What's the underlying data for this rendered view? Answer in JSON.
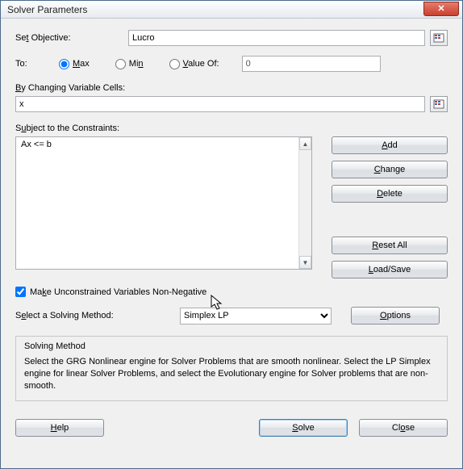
{
  "window": {
    "title": "Solver Parameters"
  },
  "objective": {
    "label_pre": "Se",
    "label_u": "t",
    "label_post": " Objective:",
    "value": "Lucro"
  },
  "to": {
    "label": "To:",
    "max_u": "M",
    "max_post": "ax",
    "min_pre": "Mi",
    "min_u": "n",
    "value_u": "V",
    "value_post": "alue Of:",
    "valueof_value": "0",
    "selected": "max"
  },
  "cells": {
    "label_u": "B",
    "label_post": "y Changing Variable Cells:",
    "value": "x"
  },
  "constraints": {
    "label_pre": "S",
    "label_u": "u",
    "label_post": "bject to the Constraints:",
    "items": [
      "Ax <= b"
    ],
    "buttons": {
      "add_u": "A",
      "add_post": "dd",
      "change_u": "C",
      "change_post": "hange",
      "delete_u": "D",
      "delete_post": "elete",
      "reset_u": "R",
      "reset_post": "eset All",
      "load_u": "L",
      "load_post": "oad/Save"
    }
  },
  "checkbox": {
    "pre": "Ma",
    "u": "k",
    "post": "e Unconstrained Variables Non-Negative",
    "checked": true
  },
  "method": {
    "label_pre": "S",
    "label_u": "e",
    "label_post": "lect a Solving Method:",
    "value": "Simplex LP",
    "options_u": "O",
    "options_post": "ptions"
  },
  "desc": {
    "title": "Solving Method",
    "text": "Select the GRG Nonlinear engine for Solver Problems that are smooth nonlinear. Select the LP Simplex engine for linear Solver Problems, and select the Evolutionary engine for Solver problems that are non-smooth."
  },
  "footer": {
    "help_u": "H",
    "help_post": "elp",
    "solve_u": "S",
    "solve_post": "olve",
    "close_pre": "Cl",
    "close_u": "o",
    "close_post": "se"
  }
}
